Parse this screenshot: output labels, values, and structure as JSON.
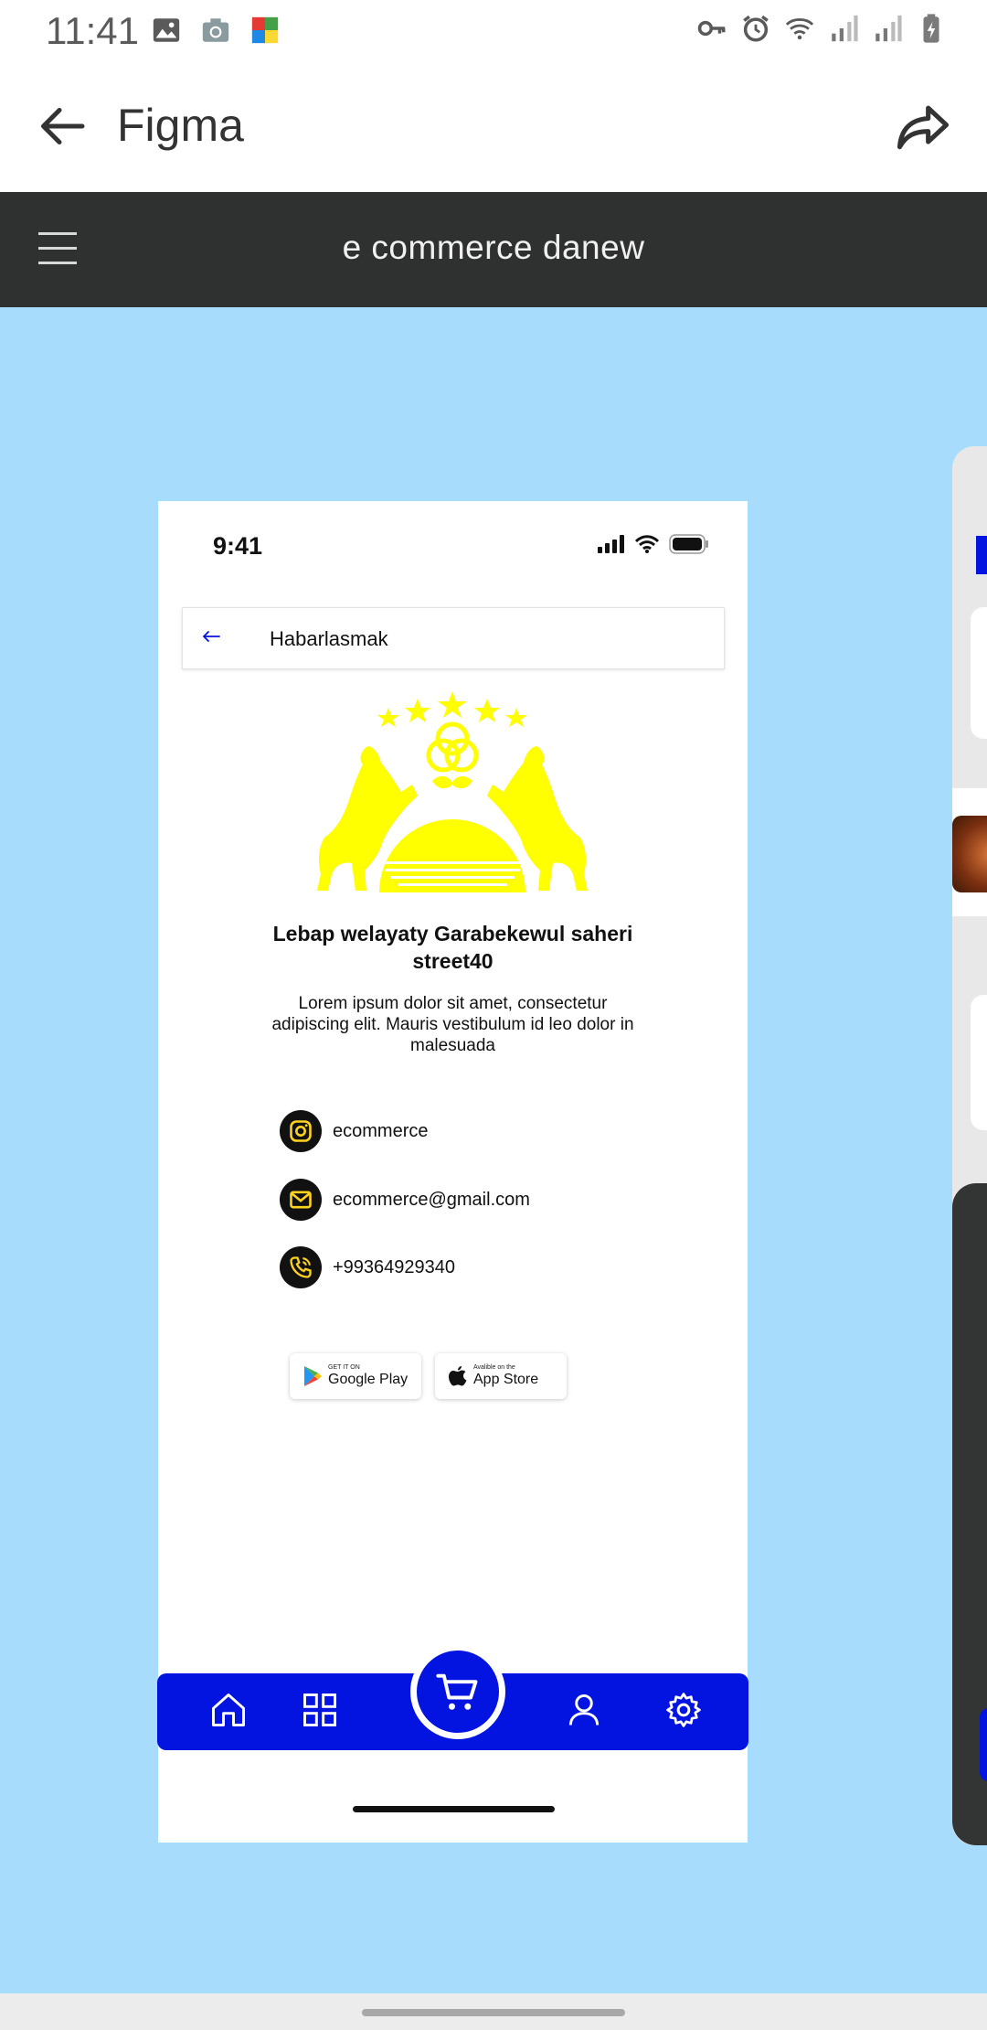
{
  "status_bar": {
    "time": "11:41"
  },
  "app_bar": {
    "title": "Figma"
  },
  "figma": {
    "file_title": "e commerce danew"
  },
  "frame": {
    "status_time": "9:41",
    "header_title": "Habarlasmak",
    "address": "Lebap welayaty Garabekewul saheri street40",
    "description": "Lorem ipsum dolor sit amet, consectetur adipiscing   elit. Mauris vestibulum id leo dolor in malesuada",
    "contacts": [
      {
        "icon": "instagram-icon",
        "text": "ecommerce"
      },
      {
        "icon": "mail-icon",
        "text": "ecommerce@gmail.com"
      },
      {
        "icon": "phone-icon",
        "text": "+99364929340"
      }
    ],
    "google_play": {
      "small": "GET IT ON",
      "big": "Google Play"
    },
    "app_store": {
      "small": "Avalible on the",
      "big": "App Store"
    },
    "nav": [
      "home-icon",
      "grid-icon",
      "cart-icon",
      "user-icon",
      "settings-icon"
    ]
  },
  "colors": {
    "canvas": "#a8dcfc",
    "header": "#2f3030",
    "brand_blue": "#0414e0",
    "accent_yellow": "#ffd21f",
    "logo_yellow": "#ffff00"
  }
}
